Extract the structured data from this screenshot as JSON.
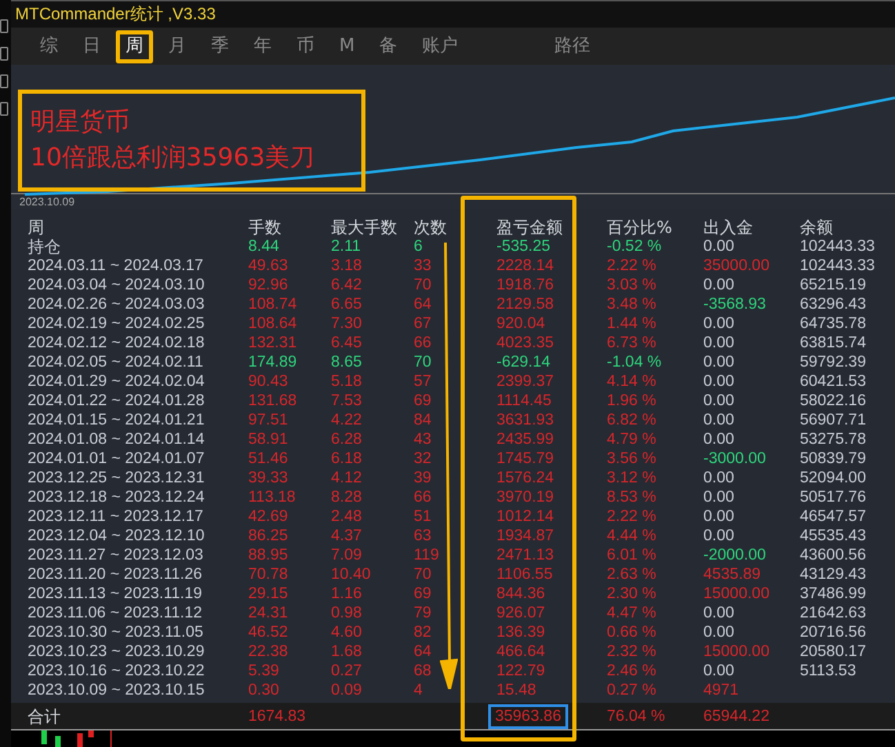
{
  "window": {
    "title": "MTCommander统计 ,V3.33"
  },
  "tabs": [
    {
      "label": "综",
      "selected": false
    },
    {
      "label": "日",
      "selected": false
    },
    {
      "label": "周",
      "selected": true
    },
    {
      "label": "月",
      "selected": false
    },
    {
      "label": "季",
      "selected": false
    },
    {
      "label": "年",
      "selected": false
    },
    {
      "label": "币",
      "selected": false
    },
    {
      "label": "M",
      "selected": false
    },
    {
      "label": "备",
      "selected": false
    },
    {
      "label": "账户",
      "selected": false
    }
  ],
  "path_tab": {
    "label": "路径",
    "selected": false
  },
  "chart": {
    "start_date": "2023.10.09"
  },
  "annotation": {
    "lines": [
      "明星货币",
      "10倍跟总利润35963美刀"
    ]
  },
  "table": {
    "columns": [
      "周",
      "手数",
      "最大手数",
      "次数",
      "盈亏金额",
      "百分比%",
      "出入金",
      "余额"
    ],
    "rows": [
      {
        "period": "持仓",
        "lots": "8.44",
        "max_lots": "2.11",
        "trades": "6",
        "pnl": "-535.25",
        "percent": "-0.52 %",
        "deposits": "0.00",
        "balance": "102443.33",
        "loss": true,
        "inflow": false,
        "outflow": false
      },
      {
        "period": "2024.03.11 ~ 2024.03.17",
        "lots": "49.63",
        "max_lots": "3.18",
        "trades": "33",
        "pnl": "2228.14",
        "percent": "2.22 %",
        "deposits": "35000.00",
        "balance": "102443.33",
        "loss": false,
        "inflow": true,
        "outflow": false
      },
      {
        "period": "2024.03.04 ~ 2024.03.10",
        "lots": "92.96",
        "max_lots": "6.42",
        "trades": "70",
        "pnl": "1918.76",
        "percent": "3.03 %",
        "deposits": "0.00",
        "balance": "65215.19",
        "loss": false,
        "inflow": false,
        "outflow": false
      },
      {
        "period": "2024.02.26 ~ 2024.03.03",
        "lots": "108.74",
        "max_lots": "6.65",
        "trades": "64",
        "pnl": "2129.58",
        "percent": "3.48 %",
        "deposits": "-3568.93",
        "balance": "63296.43",
        "loss": false,
        "inflow": false,
        "outflow": true
      },
      {
        "period": "2024.02.19 ~ 2024.02.25",
        "lots": "108.64",
        "max_lots": "7.30",
        "trades": "67",
        "pnl": "920.04",
        "percent": "1.44 %",
        "deposits": "0.00",
        "balance": "64735.78",
        "loss": false,
        "inflow": false,
        "outflow": false
      },
      {
        "period": "2024.02.12 ~ 2024.02.18",
        "lots": "132.31",
        "max_lots": "6.45",
        "trades": "66",
        "pnl": "4023.35",
        "percent": "6.73 %",
        "deposits": "0.00",
        "balance": "63815.74",
        "loss": false,
        "inflow": false,
        "outflow": false
      },
      {
        "period": "2024.02.05 ~ 2024.02.11",
        "lots": "174.89",
        "max_lots": "8.65",
        "trades": "70",
        "pnl": "-629.14",
        "percent": "-1.04 %",
        "deposits": "0.00",
        "balance": "59792.39",
        "loss": true,
        "inflow": false,
        "outflow": false
      },
      {
        "period": "2024.01.29 ~ 2024.02.04",
        "lots": "90.43",
        "max_lots": "5.18",
        "trades": "57",
        "pnl": "2399.37",
        "percent": "4.14 %",
        "deposits": "0.00",
        "balance": "60421.53",
        "loss": false,
        "inflow": false,
        "outflow": false
      },
      {
        "period": "2024.01.22 ~ 2024.01.28",
        "lots": "131.68",
        "max_lots": "7.53",
        "trades": "69",
        "pnl": "1114.45",
        "percent": "1.96 %",
        "deposits": "0.00",
        "balance": "58022.16",
        "loss": false,
        "inflow": false,
        "outflow": false
      },
      {
        "period": "2024.01.15 ~ 2024.01.21",
        "lots": "97.51",
        "max_lots": "4.22",
        "trades": "84",
        "pnl": "3631.93",
        "percent": "6.82 %",
        "deposits": "0.00",
        "balance": "56907.71",
        "loss": false,
        "inflow": false,
        "outflow": false
      },
      {
        "period": "2024.01.08 ~ 2024.01.14",
        "lots": "58.91",
        "max_lots": "6.28",
        "trades": "43",
        "pnl": "2435.99",
        "percent": "4.79 %",
        "deposits": "0.00",
        "balance": "53275.78",
        "loss": false,
        "inflow": false,
        "outflow": false
      },
      {
        "period": "2024.01.01 ~ 2024.01.07",
        "lots": "51.46",
        "max_lots": "6.18",
        "trades": "32",
        "pnl": "1745.79",
        "percent": "3.56 %",
        "deposits": "-3000.00",
        "balance": "50839.79",
        "loss": false,
        "inflow": false,
        "outflow": true
      },
      {
        "period": "2023.12.25 ~ 2023.12.31",
        "lots": "39.33",
        "max_lots": "4.12",
        "trades": "39",
        "pnl": "1576.24",
        "percent": "3.12 %",
        "deposits": "0.00",
        "balance": "52094.00",
        "loss": false,
        "inflow": false,
        "outflow": false
      },
      {
        "period": "2023.12.18 ~ 2023.12.24",
        "lots": "113.18",
        "max_lots": "8.28",
        "trades": "66",
        "pnl": "3970.19",
        "percent": "8.53 %",
        "deposits": "0.00",
        "balance": "50517.76",
        "loss": false,
        "inflow": false,
        "outflow": false
      },
      {
        "period": "2023.12.11 ~ 2023.12.17",
        "lots": "42.69",
        "max_lots": "2.48",
        "trades": "51",
        "pnl": "1012.14",
        "percent": "2.22 %",
        "deposits": "0.00",
        "balance": "46547.57",
        "loss": false,
        "inflow": false,
        "outflow": false
      },
      {
        "period": "2023.12.04 ~ 2023.12.10",
        "lots": "86.25",
        "max_lots": "4.37",
        "trades": "63",
        "pnl": "1934.87",
        "percent": "4.44 %",
        "deposits": "0.00",
        "balance": "45535.43",
        "loss": false,
        "inflow": false,
        "outflow": false
      },
      {
        "period": "2023.11.27 ~ 2023.12.03",
        "lots": "88.95",
        "max_lots": "7.09",
        "trades": "119",
        "pnl": "2471.13",
        "percent": "6.01 %",
        "deposits": "-2000.00",
        "balance": "43600.56",
        "loss": false,
        "inflow": false,
        "outflow": true
      },
      {
        "period": "2023.11.20 ~ 2023.11.26",
        "lots": "70.78",
        "max_lots": "10.40",
        "trades": "70",
        "pnl": "1106.55",
        "percent": "2.63 %",
        "deposits": "4535.89",
        "balance": "43129.43",
        "loss": false,
        "inflow": true,
        "outflow": false
      },
      {
        "period": "2023.11.13 ~ 2023.11.19",
        "lots": "29.15",
        "max_lots": "1.16",
        "trades": "69",
        "pnl": "844.36",
        "percent": "2.30 %",
        "deposits": "15000.00",
        "balance": "37486.99",
        "loss": false,
        "inflow": true,
        "outflow": false
      },
      {
        "period": "2023.11.06 ~ 2023.11.12",
        "lots": "24.31",
        "max_lots": "0.98",
        "trades": "79",
        "pnl": "926.07",
        "percent": "4.47 %",
        "deposits": "0.00",
        "balance": "21642.63",
        "loss": false,
        "inflow": false,
        "outflow": false
      },
      {
        "period": "2023.10.30 ~ 2023.11.05",
        "lots": "46.52",
        "max_lots": "4.60",
        "trades": "82",
        "pnl": "136.39",
        "percent": "0.66 %",
        "deposits": "0.00",
        "balance": "20716.56",
        "loss": false,
        "inflow": false,
        "outflow": false
      },
      {
        "period": "2023.10.23 ~ 2023.10.29",
        "lots": "22.38",
        "max_lots": "1.68",
        "trades": "64",
        "pnl": "466.64",
        "percent": "2.32 %",
        "deposits": "15000.00",
        "balance": "20580.17",
        "loss": false,
        "inflow": true,
        "outflow": false
      },
      {
        "period": "2023.10.16 ~ 2023.10.22",
        "lots": "5.39",
        "max_lots": "0.27",
        "trades": "68",
        "pnl": "122.79",
        "percent": "2.46 %",
        "deposits": "0.00",
        "balance": "5113.53",
        "loss": false,
        "inflow": false,
        "outflow": false
      },
      {
        "period": "2023.10.09 ~ 2023.10.15",
        "lots": "0.30",
        "max_lots": "0.09",
        "trades": "4",
        "pnl": "15.48",
        "percent": "0.27 %",
        "deposits": "4971",
        "loss": false,
        "inflow": true,
        "outflow": false
      }
    ],
    "total": {
      "label": "合计",
      "lots": "1674.83",
      "pnl": "35963.86",
      "percent": "76.04 %",
      "deposits": "65944.22",
      "highlighted": true
    }
  }
}
